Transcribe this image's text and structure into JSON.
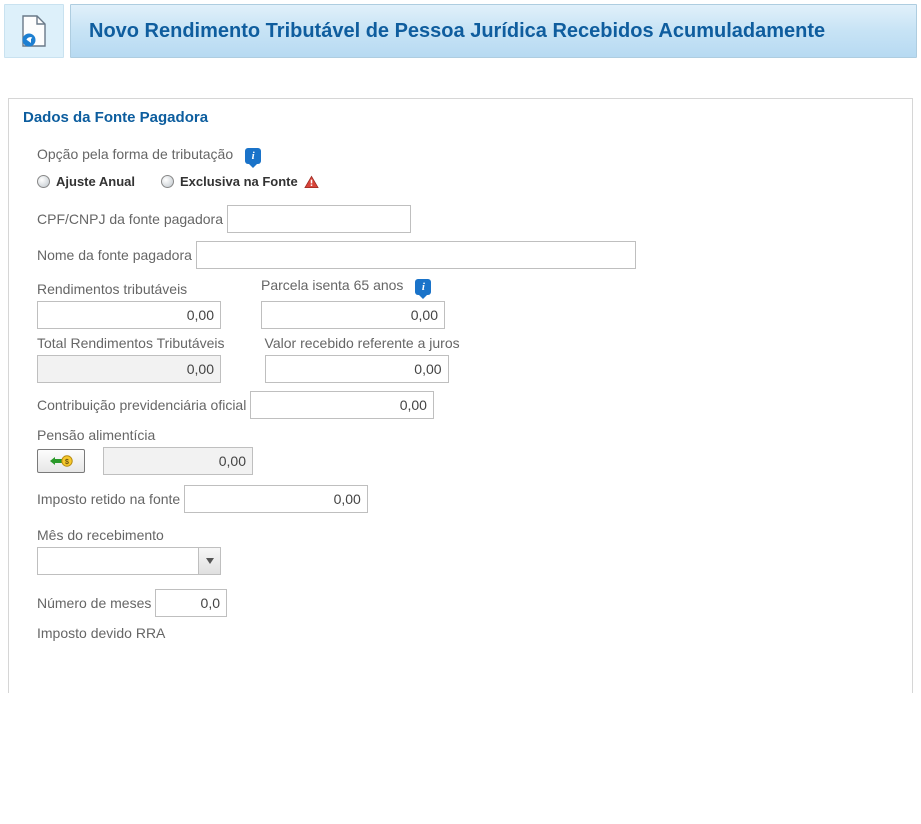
{
  "header": {
    "title": "Novo Rendimento Tributável de Pessoa Jurídica Recebidos Acumuladamente"
  },
  "panel": {
    "title": "Dados da Fonte Pagadora"
  },
  "form": {
    "taxation_option_label": "Opção pela forma de tributação",
    "radio_ajuste": "Ajuste Anual",
    "radio_exclusiva": "Exclusiva na Fonte",
    "cpf_cnpj_label": "CPF/CNPJ da fonte pagadora",
    "cpf_cnpj_value": "",
    "nome_label": "Nome da fonte pagadora",
    "nome_value": "",
    "rend_trib_label": "Rendimentos tributáveis",
    "rend_trib_value": "0,00",
    "parcela65_label": "Parcela isenta 65 anos",
    "parcela65_value": "0,00",
    "total_rend_label": "Total Rendimentos Tributáveis",
    "total_rend_value": "0,00",
    "valor_juros_label": "Valor recebido referente a juros",
    "valor_juros_value": "0,00",
    "contrib_prev_label": "Contribuição previdenciária oficial",
    "contrib_prev_value": "0,00",
    "pensao_label": "Pensão alimentícia",
    "pensao_value": "0,00",
    "imposto_retido_label": "Imposto retido na fonte",
    "imposto_retido_value": "0,00",
    "mes_receb_label": "Mês do recebimento",
    "mes_receb_value": "",
    "num_meses_label": "Número de meses",
    "num_meses_value": "0,0",
    "imposto_rra_label": "Imposto devido RRA"
  }
}
